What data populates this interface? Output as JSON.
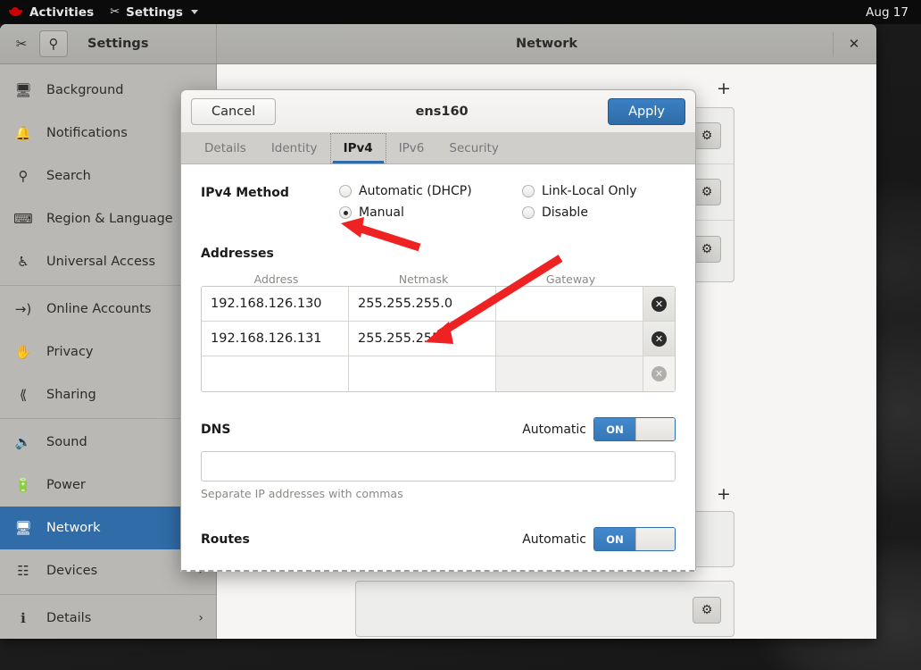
{
  "topbar": {
    "logo": "redhat-logo",
    "activities": "Activities",
    "app_menu": "Settings",
    "app_menu_icon": "tools-icon",
    "clock": "Aug 17"
  },
  "settings_window": {
    "app_title": "Settings",
    "window_title": "Network",
    "search_icon": "search-icon",
    "tools_icon": "tools-icon",
    "close_icon": "close-icon",
    "sidebar": {
      "items": [
        {
          "label": "Background",
          "icon": "monitor-icon",
          "selected": false,
          "chevron": ""
        },
        {
          "label": "Notifications",
          "icon": "bell-icon",
          "selected": false,
          "chevron": ""
        },
        {
          "label": "Search",
          "icon": "search-icon",
          "selected": false,
          "chevron": ""
        },
        {
          "label": "Region & Language",
          "icon": "keyboard-icon",
          "selected": false,
          "chevron": ""
        },
        {
          "label": "Universal Access",
          "icon": "accessibility-icon",
          "selected": false,
          "chevron": ""
        },
        {
          "label": "Online Accounts",
          "icon": "online-accounts-icon",
          "selected": false,
          "chevron": ""
        },
        {
          "label": "Privacy",
          "icon": "hand-icon",
          "selected": false,
          "chevron": ""
        },
        {
          "label": "Sharing",
          "icon": "share-icon",
          "selected": false,
          "chevron": ""
        },
        {
          "label": "Sound",
          "icon": "speaker-icon",
          "selected": false,
          "chevron": ""
        },
        {
          "label": "Power",
          "icon": "power-plug-icon",
          "selected": false,
          "chevron": ""
        },
        {
          "label": "Network",
          "icon": "network-icon",
          "selected": true,
          "chevron": ""
        },
        {
          "label": "Devices",
          "icon": "devices-icon",
          "selected": false,
          "chevron": "›"
        },
        {
          "label": "Details",
          "icon": "info-icon",
          "selected": false,
          "chevron": "›"
        }
      ]
    },
    "network_panel": {
      "add_button_label": "+",
      "gear_icon": "gear-icon"
    }
  },
  "dialog": {
    "cancel_label": "Cancel",
    "title": "ens160",
    "apply_label": "Apply",
    "tabs": [
      {
        "label": "Details",
        "active": false
      },
      {
        "label": "Identity",
        "active": false
      },
      {
        "label": "IPv4",
        "active": true
      },
      {
        "label": "IPv6",
        "active": false
      },
      {
        "label": "Security",
        "active": false
      }
    ],
    "ipv4_method": {
      "label": "IPv4 Method",
      "options": [
        {
          "label": "Automatic (DHCP)",
          "selected": false
        },
        {
          "label": "Link-Local Only",
          "selected": false
        },
        {
          "label": "Manual",
          "selected": true
        },
        {
          "label": "Disable",
          "selected": false
        }
      ]
    },
    "addresses": {
      "title": "Addresses",
      "columns": [
        "Address",
        "Netmask",
        "Gateway"
      ],
      "rows": [
        {
          "address": "192.168.126.130",
          "netmask": "255.255.255.0",
          "gateway": "",
          "gateway_disabled": false,
          "delete_active": true
        },
        {
          "address": "192.168.126.131",
          "netmask": "255.255.255.0",
          "gateway": "",
          "gateway_disabled": true,
          "delete_active": true
        },
        {
          "address": "",
          "netmask": "",
          "gateway": "",
          "gateway_disabled": true,
          "delete_active": false
        }
      ],
      "delete_icon": "delete-circle-icon"
    },
    "dns": {
      "title": "DNS",
      "automatic_label": "Automatic",
      "toggle_state": "ON",
      "value": "",
      "hint": "Separate IP addresses with commas"
    },
    "routes": {
      "title": "Routes",
      "automatic_label": "Automatic",
      "toggle_state": "ON"
    }
  },
  "annotations": {
    "arrow_1_target": "manual-radio-button",
    "arrow_2_target": "second-address-row",
    "color": "#ee2222"
  },
  "colors": {
    "accent_blue": "#2f6ca8",
    "toggle_blue": "#3578b9",
    "annotation_red": "#ee2222",
    "topbar_black": "#0b0b0b",
    "sidebar_gray": "#b9b8b5"
  }
}
